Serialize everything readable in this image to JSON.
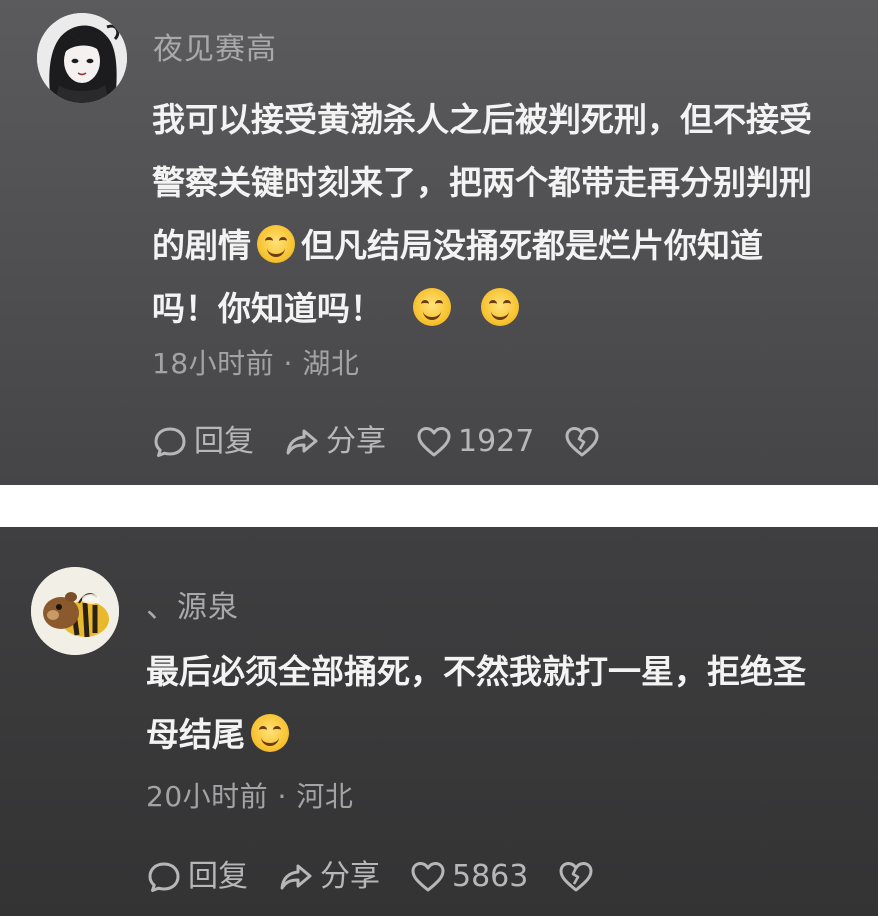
{
  "comments": [
    {
      "username": "夜见赛高",
      "content_lines": [
        "我可以接受黄渤杀人之后被判死刑，但不接受",
        "警察关键时刻来了，把两个都带走再分别判刑",
        "的剧情",
        "但凡结局没捅死都是烂片你知道",
        "吗！你知道吗！"
      ],
      "meta": "18小时前 · 湖北",
      "reply_label": "回复",
      "share_label": "分享",
      "like_count": "1927"
    },
    {
      "username": "、源泉",
      "content_lines": [
        "最后必须全部捅死，不然我就打一星，拒绝圣",
        "母结尾"
      ],
      "meta": "20小时前 · 河北",
      "reply_label": "回复",
      "share_label": "分享",
      "like_count": "5863"
    }
  ],
  "icons": {
    "emoji": "smiling-face-icon",
    "reply": "comment-bubble-icon",
    "share": "share-arrow-icon",
    "like": "heart-icon",
    "dislike": "broken-heart-icon"
  },
  "colors": {
    "card_bg_top": "#5b5b5d",
    "card_bg_bottom": "#333334",
    "text_primary": "#f3f3f3",
    "text_secondary": "#a9a9ab",
    "separator": "#ffffff"
  }
}
